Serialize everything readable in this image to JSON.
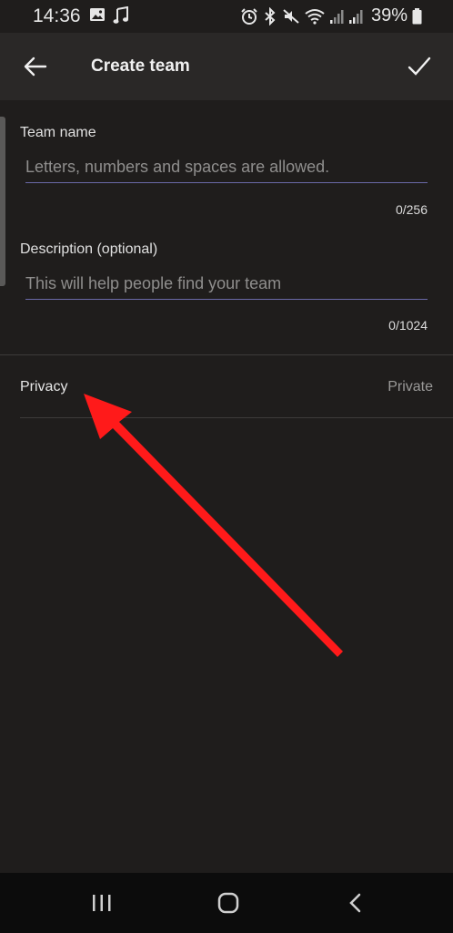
{
  "status_bar": {
    "time": "14:36",
    "battery": "39%"
  },
  "app_bar": {
    "title": "Create team"
  },
  "form": {
    "team_name": {
      "label": "Team name",
      "value": "",
      "placeholder": "Letters, numbers and spaces are allowed.",
      "counter": "0/256"
    },
    "description": {
      "label": "Description (optional)",
      "value": "",
      "placeholder": "This will help people find your team",
      "counter": "0/1024"
    },
    "privacy": {
      "label": "Privacy",
      "value": "Private"
    }
  },
  "colors": {
    "background": "#1f1d1c",
    "app_bar": "#2a2827",
    "input_underline": "#6a69a8",
    "annotation_arrow": "#ff1a1a",
    "nav_bar": "#0c0c0c"
  },
  "icons": {
    "back": "arrow-left-icon",
    "confirm": "check-icon",
    "nav_recents": "recents-icon",
    "nav_home": "home-icon",
    "nav_back": "chevron-left-icon"
  }
}
